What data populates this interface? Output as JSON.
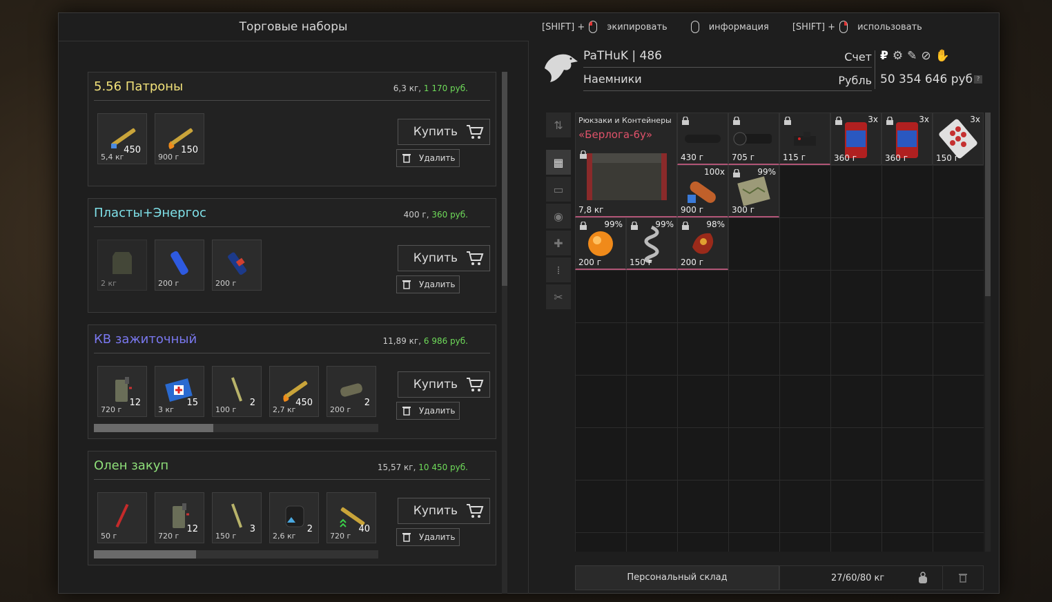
{
  "header": {
    "title": "Торговые наборы",
    "hints": [
      {
        "prefix": "[SHIFT] +",
        "label": "экипировать"
      },
      {
        "prefix": "",
        "label": "информация"
      },
      {
        "prefix": "[SHIFT] +",
        "label": "использовать"
      }
    ]
  },
  "kits": [
    {
      "name": "5.56 Патроны",
      "name_color": "#f2e27a",
      "weight": "6,3 кг,",
      "price": "1 170 руб.",
      "items": [
        {
          "icon": "ammo-icon",
          "count": "450",
          "weight": "5,4 кг"
        },
        {
          "icon": "ammo-fire-icon",
          "count": "150",
          "weight": "900 г"
        }
      ],
      "buy": "Купить",
      "delete": "Удалить"
    },
    {
      "name": "Пласты+Энергос",
      "name_color": "#7fe0e8",
      "weight": "400 г,",
      "price": "360 руб.",
      "items": [
        {
          "icon": "armor-plate-icon",
          "count": "",
          "weight": "2 кг"
        },
        {
          "icon": "energy-drink-icon",
          "count": "",
          "weight": "200 г"
        },
        {
          "icon": "energy-bottle-icon",
          "count": "",
          "weight": "200 г"
        }
      ],
      "buy": "Купить",
      "delete": "Удалить"
    },
    {
      "name": "КВ зажиточный",
      "name_color": "#7a78f0",
      "weight": "11,89 кг,",
      "price": "6 986 руб.",
      "items": [
        {
          "icon": "canister-icon",
          "count": "12",
          "weight": "720 г"
        },
        {
          "icon": "medkit-icon",
          "count": "15",
          "weight": "3 кг"
        },
        {
          "icon": "syringe-icon",
          "count": "2",
          "weight": "100 г"
        },
        {
          "icon": "ammo-fire-icon",
          "count": "450",
          "weight": "2,7 кг"
        },
        {
          "icon": "bandage-icon",
          "count": "2",
          "weight": "200 г"
        }
      ],
      "progress": 0.42,
      "buy": "Купить",
      "delete": "Удалить"
    },
    {
      "name": "Олен закуп",
      "name_color": "#8fe07a",
      "weight": "15,57 кг,",
      "price": "10 450 руб.",
      "items": [
        {
          "icon": "red-injector-icon",
          "count": "",
          "weight": "50 г"
        },
        {
          "icon": "canister-icon",
          "count": "12",
          "weight": "720 г"
        },
        {
          "icon": "syringe-icon",
          "count": "3",
          "weight": "150 г"
        },
        {
          "icon": "grenade-box-icon",
          "count": "2",
          "weight": "2,6 кг"
        },
        {
          "icon": "ammo-upgrade-icon",
          "count": "40",
          "weight": "720 г"
        }
      ],
      "progress": 0.36,
      "buy": "Купить",
      "delete": "Удалить"
    }
  ],
  "player": {
    "name": "PaTHuK",
    "level": "486",
    "faction": "Наемники",
    "account_label": "Счет",
    "currency_label": "Рубль",
    "balance": "50 354 646 руб.",
    "help": "?"
  },
  "inventory": {
    "container": {
      "category": "Рюкзаки и Контейнеры",
      "name": "«Берлога-6у»",
      "weight": "7,8 кг"
    },
    "items": [
      {
        "icon": "suppressor-icon",
        "weight": "430 г",
        "corner": ""
      },
      {
        "icon": "scope-icon",
        "weight": "705 г",
        "corner": ""
      },
      {
        "icon": "sight-icon",
        "weight": "115 г",
        "corner": ""
      },
      {
        "icon": "jar-icon",
        "weight": "360 г",
        "corner": "3x"
      },
      {
        "icon": "jar-icon",
        "weight": "360 г",
        "corner": "3x"
      },
      {
        "icon": "pills-icon",
        "weight": "150 г",
        "corner": "3x"
      },
      {
        "icon": "bullet-icon",
        "weight": "900 г",
        "corner": "100x"
      },
      {
        "icon": "map-icon",
        "weight": "300 г",
        "corner": "99%"
      },
      {
        "icon": "artifact-orange-icon",
        "weight": "200 г",
        "corner": "99%"
      },
      {
        "icon": "artifact-spiral-icon",
        "weight": "150 г",
        "corner": "99%"
      },
      {
        "icon": "artifact-red-icon",
        "weight": "200 г",
        "corner": "98%"
      }
    ],
    "stash_label": "Персональный склад",
    "weight_text": "27/60/80 кг"
  },
  "colors": {
    "accent_green": "#6fdc5a",
    "pink_border": "#b25577",
    "container_name": "#e0526a"
  }
}
